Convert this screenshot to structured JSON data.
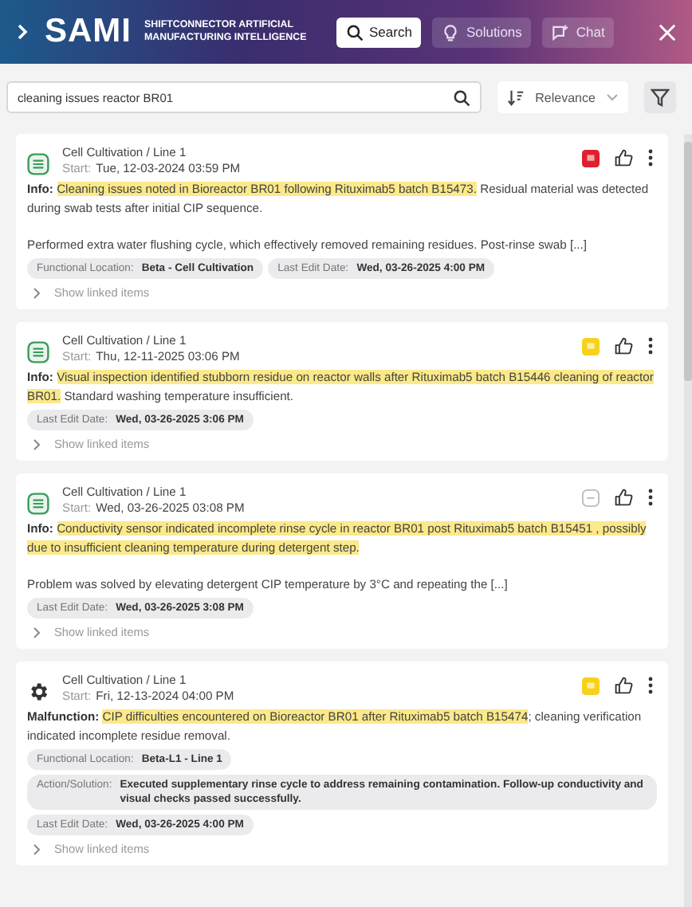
{
  "header": {
    "logo": "SAMI",
    "subtitle": "SHIFTCONNECTOR ARTIFICIAL MANUFACTURING INTELLIGENCE",
    "tabs": [
      {
        "label": "Search",
        "selected": true
      },
      {
        "label": "Solutions",
        "selected": false
      },
      {
        "label": "Chat",
        "selected": false
      }
    ]
  },
  "search": {
    "value": "cleaning issues reactor BR01"
  },
  "sort": {
    "label": "Relevance"
  },
  "results": [
    {
      "kind": "info",
      "path": "Cell Cultivation / Line 1",
      "start_label": "Start:",
      "start": "Tue, 12-03-2024 03:59 PM",
      "flag": {
        "color": "#e0202e"
      },
      "summary": [
        {
          "text": "Info: ",
          "kind": "label"
        },
        {
          "text": "Cleaning issues noted in Bioreactor BR01 following Rituximab5 batch B15473.",
          "kind": "highlight"
        },
        {
          "text": " Residual material was detected during swab tests after initial CIP sequence.",
          "kind": "plain"
        }
      ],
      "note": "Performed extra water flushing cycle, which effectively removed remaining residues. Post-rinse swab [...]",
      "tags": [
        {
          "label": "Functional Location:",
          "value": "Beta - Cell Cultivation"
        },
        {
          "label": "Last Edit Date:",
          "value": "Wed, 03-26-2025 4:00 PM"
        }
      ],
      "linked": {
        "label": "Show linked items",
        "expanded": false
      }
    },
    {
      "kind": "info",
      "path": "Cell Cultivation / Line 1",
      "start_label": "Start:",
      "start": "Thu, 12-11-2025 03:06 PM",
      "flag": {
        "color": "#f7d21a"
      },
      "summary": [
        {
          "text": "Info: ",
          "kind": "label"
        },
        {
          "text": "Visual inspection identified stubborn residue on reactor walls after Rituximab5 batch B15446 cleaning of reactor BR01.",
          "kind": "highlight"
        },
        {
          "text": " Standard washing temperature insufficient.",
          "kind": "plain"
        }
      ],
      "tags": [
        {
          "label": "Last Edit Date:",
          "value": "Wed, 03-26-2025 3:06 PM"
        }
      ],
      "linked": {
        "label": "Show linked items",
        "expanded": false
      }
    },
    {
      "kind": "info",
      "path": "Cell Cultivation / Line 1",
      "start_label": "Start:",
      "start": "Wed, 03-26-2025 03:08 PM",
      "summary": [
        {
          "text": "Info: ",
          "kind": "label"
        },
        {
          "text": "Conductivity sensor indicated incomplete rinse cycle in reactor BR01 post Rituximab5 batch B15451 , possibly due to insufficient cleaning temperature during detergent step.",
          "kind": "highlight"
        }
      ],
      "note": "Problem was solved by elevating detergent CIP temperature by 3°C and repeating the [...]",
      "tags": [
        {
          "label": "Last Edit Date:",
          "value": "Wed, 03-26-2025 3:08 PM"
        }
      ],
      "linked": {
        "label": "Show linked items",
        "expanded": false
      }
    },
    {
      "kind": "malfunction",
      "path": "Cell Cultivation / Line 1",
      "start_label": "Start:",
      "start": "Fri, 12-13-2024 04:00 PM",
      "flag": {
        "color": "#f7d21a"
      },
      "summary": [
        {
          "text": "Malfunction: ",
          "kind": "label"
        },
        {
          "text": "CIP difficulties encountered on Bioreactor BR01 after Rituximab5 batch B15474",
          "kind": "highlight"
        },
        {
          "text": "; cleaning verification indicated incomplete residue removal.",
          "kind": "plain"
        }
      ],
      "tags": [
        {
          "label": "Functional Location:",
          "value": "Beta-L1 - Line 1"
        },
        {
          "label": "Action/Solution:",
          "value": "Executed supplementary rinse cycle to address remaining contamination. Follow-up conductivity and visual checks passed successfully."
        },
        {
          "label": "Last Edit Date:",
          "value": "Wed, 03-26-2025 4:00 PM"
        }
      ],
      "linked": {
        "label": "Show linked items",
        "expanded": false
      }
    }
  ]
}
